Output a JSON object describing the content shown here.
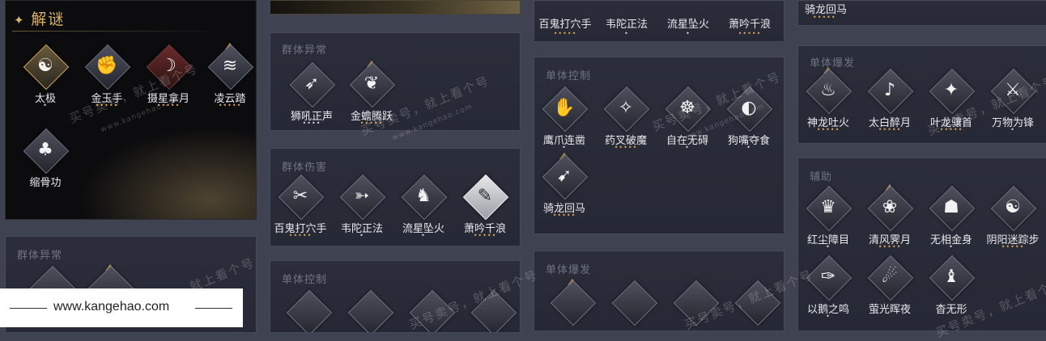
{
  "puzzle_panel": {
    "title": "解谜",
    "skills": [
      {
        "name": "太极",
        "dots": "•",
        "glyph": "☯",
        "style": "gold",
        "tri": false
      },
      {
        "name": "金玉手",
        "dots": "•••••",
        "glyph": "✊",
        "style": "",
        "tri": false
      },
      {
        "name": "摄星拿月",
        "dots": "•••••",
        "glyph": "☽",
        "style": "red",
        "tri": false
      },
      {
        "name": "凌云踏",
        "dots": "•••••",
        "glyph": "≋",
        "style": "",
        "tri": true
      },
      {
        "name": "缩骨功",
        "dots": "",
        "glyph": "♣",
        "style": "",
        "tri": false
      }
    ]
  },
  "left_lower_panel": {
    "title": "群体异常"
  },
  "col2_group_abnormal": {
    "title": "群体异常",
    "skills": [
      {
        "name": "狮吼正声",
        "dots": "••••",
        "glyph": "➶",
        "style": "",
        "tri": false
      },
      {
        "name": "金蟾腾跃",
        "dots": "•••••",
        "glyph": "❦",
        "style": "",
        "tri": true
      }
    ]
  },
  "col2_group_damage": {
    "title": "群体伤害",
    "skills": [
      {
        "name": "百鬼打穴手",
        "dots": "•••••",
        "glyph": "✂",
        "style": "",
        "tri": false
      },
      {
        "name": "韦陀正法",
        "dots": "•",
        "glyph": "➳",
        "style": "",
        "tri": false
      },
      {
        "name": "流星坠火",
        "dots": "•",
        "glyph": "♞",
        "style": "",
        "tri": false
      },
      {
        "name": "萧吟千浪",
        "dots": "•••••",
        "glyph": "✎",
        "style": "lit",
        "tri": false
      }
    ]
  },
  "col2_single_control": {
    "title": "单体控制"
  },
  "col3_top_row": {
    "skills": [
      {
        "name": "百鬼打穴手",
        "dots": "•••••"
      },
      {
        "name": "韦陀正法",
        "dots": "•"
      },
      {
        "name": "流星坠火",
        "dots": "•"
      },
      {
        "name": "萧吟千浪",
        "dots": "•••••"
      }
    ]
  },
  "col3_single_control": {
    "title": "单体控制",
    "skills": [
      {
        "name": "鹰爪连凿",
        "dots": "•",
        "glyph": "✋",
        "style": "",
        "tri": false
      },
      {
        "name": "药叉破魔",
        "dots": "•••••",
        "glyph": "✧",
        "style": "",
        "tri": false
      },
      {
        "name": "自在无碍",
        "dots": "•",
        "glyph": "☸",
        "style": "",
        "tri": false
      },
      {
        "name": "狗嘴夺食",
        "dots": "•",
        "glyph": "◐",
        "style": "",
        "tri": false
      },
      {
        "name": "骑龙回马",
        "dots": "•••••",
        "glyph": "➹",
        "style": "",
        "tri": true
      }
    ]
  },
  "col3_single_burst": {
    "title": "单体爆发"
  },
  "col4_top": {
    "skill": {
      "name": "骑龙回马",
      "dots": "•••••"
    }
  },
  "col4_single_burst": {
    "title": "单体爆发",
    "skills": [
      {
        "name": "神龙吐火",
        "dots": "•••••",
        "glyph": "♨",
        "style": "",
        "tri": true
      },
      {
        "name": "太白醉月",
        "dots": "•••••",
        "glyph": "♪",
        "style": "",
        "tri": false
      },
      {
        "name": "叶龙骧首",
        "dots": "•••••",
        "glyph": "✦",
        "style": "",
        "tri": false
      },
      {
        "name": "万物为锋",
        "dots": "•",
        "glyph": "⚔",
        "style": "",
        "tri": false
      }
    ]
  },
  "col4_assist": {
    "title": "辅助",
    "skills": [
      {
        "name": "红尘障目",
        "dots": "•",
        "glyph": "♛",
        "style": "",
        "tri": false
      },
      {
        "name": "清风霁月",
        "dots": "•••••",
        "glyph": "❀",
        "style": "",
        "tri": true
      },
      {
        "name": "无相金身",
        "dots": "•",
        "glyph": "☗",
        "style": "",
        "tri": false
      },
      {
        "name": "阴阳迷踪步",
        "dots": "•••••",
        "glyph": "☯",
        "style": "",
        "tri": false
      },
      {
        "name": "以鹅之鸣",
        "dots": "•",
        "glyph": "✑",
        "style": "",
        "tri": false
      },
      {
        "name": "萤光晖夜",
        "dots": "",
        "glyph": "☄",
        "style": "",
        "tri": false
      },
      {
        "name": "杳无形",
        "dots": "",
        "glyph": "♝",
        "style": "",
        "tri": false
      }
    ]
  },
  "watermark": {
    "text": "买号卖号，就上看个号",
    "domain": "www.kangehao.com",
    "badge": "看个号"
  },
  "site_bar": {
    "url": "www.kangehao.com"
  }
}
